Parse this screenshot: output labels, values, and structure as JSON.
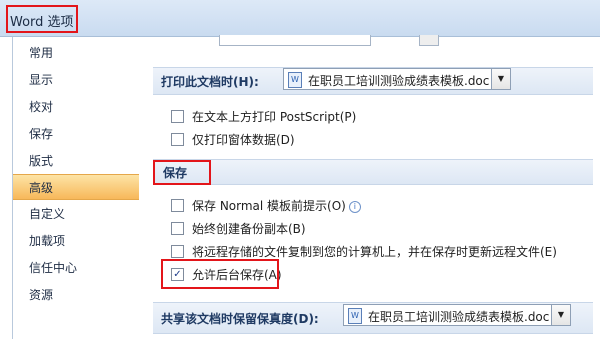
{
  "window": {
    "title": "Word 选项"
  },
  "nav": {
    "items": [
      {
        "label": "常用"
      },
      {
        "label": "显示"
      },
      {
        "label": "校对"
      },
      {
        "label": "保存"
      },
      {
        "label": "版式"
      },
      {
        "label": "高级",
        "active": true
      },
      {
        "label": "自定义"
      },
      {
        "label": "加载项"
      },
      {
        "label": "信任中心"
      },
      {
        "label": "资源"
      }
    ]
  },
  "print_section": {
    "label": "打印此文档时(H):",
    "document": "在职员工培训测验成绩表模板.doc",
    "options": [
      {
        "label": "在文本上方打印 PostScript(P)",
        "checked": false
      },
      {
        "label": "仅打印窗体数据(D)",
        "checked": false
      }
    ]
  },
  "save_section": {
    "label": "保存",
    "options": [
      {
        "label": "保存 Normal 模板前提示(O)",
        "checked": false,
        "info": true
      },
      {
        "label": "始终创建备份副本(B)",
        "checked": false
      },
      {
        "label": "将远程存储的文件复制到您的计算机上，并在保存时更新远程文件(E)",
        "checked": false
      },
      {
        "label": "允许后台保存(A)",
        "checked": true
      }
    ]
  },
  "share_section": {
    "label": "共享该文档时保留保真度(D):",
    "document": "在职员工培训测验成绩表模板.doc"
  },
  "colors": {
    "highlight": "#e3151a",
    "active_nav": "#f7b85a"
  }
}
